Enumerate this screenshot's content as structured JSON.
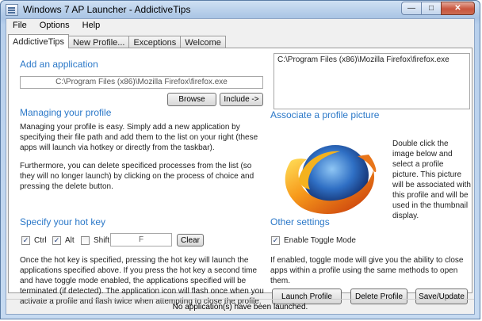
{
  "window": {
    "title": "Windows 7 AP Launcher - AddictiveTips"
  },
  "menu": [
    "File",
    "Options",
    "Help"
  ],
  "tabs": [
    "AddictiveTips",
    "New Profile...",
    "Exceptions",
    "Welcome"
  ],
  "add_app": {
    "heading": "Add an application",
    "path_value": "C:\\Program Files (x86)\\Mozilla Firefox\\firefox.exe",
    "browse_label": "Browse",
    "include_label": "Include ->"
  },
  "app_list": {
    "items": [
      "C:\\Program Files (x86)\\Mozilla Firefox\\firefox.exe"
    ]
  },
  "managing": {
    "heading": "Managing your profile",
    "para1": "Managing your profile is easy. Simply add a new application by specifying their file path and add them to the list on your right (these apps will launch via hotkey or directly from the taskbar).",
    "para2": "Furthermore, you can delete specificed processes from the list (so they will no longer launch) by clicking on the process of choice and pressing the delete button."
  },
  "picture": {
    "heading": "Associate a profile picture",
    "text": "Double click the image below and select a profile picture. This picture will be associated with this profile and will be used in the thumbnail display."
  },
  "hotkey": {
    "heading": "Specify your hot key",
    "ctrl_label": "Ctrl",
    "ctrl_checked": true,
    "alt_label": "Alt",
    "alt_checked": true,
    "shift_label": "Shift",
    "shift_checked": false,
    "key_value": "F",
    "clear_label": "Clear",
    "text": "Once the hot key is specified, pressing the hot key will launch the applications specified above. If you press the hot key a second time and have toggle mode enabled, the applications specified will be terminated (if detected). The application icon will flash once when you activate a profile and flash twice when attempting to close the profile."
  },
  "other": {
    "heading": "Other settings",
    "toggle_label": "Enable Toggle Mode",
    "toggle_checked": true,
    "text": "If enabled, toggle mode will give you the ability to close apps within a profile using the same methods to open them."
  },
  "actions": {
    "launch_label": "Launch Profile",
    "delete_label": "Delete Profile",
    "save_label": "Save/Update"
  },
  "status": {
    "text": "No application(s) have been launched."
  },
  "colors": {
    "heading": "#2b78c8",
    "title_bar": "#b8d0ec",
    "close_button": "#c9553d"
  },
  "icons": {
    "app": "window-icon",
    "minimize": "minimize-icon",
    "maximize": "maximize-icon",
    "close": "close-icon",
    "check": "checkmark-icon",
    "profile_picture": "firefox-logo"
  }
}
